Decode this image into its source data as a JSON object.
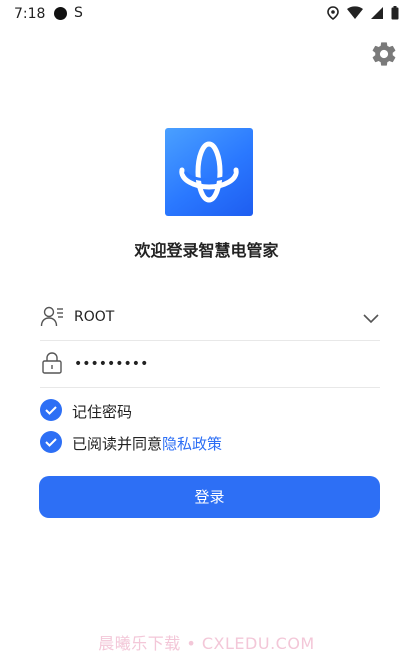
{
  "status_bar": {
    "time": "7:18",
    "icons": [
      "record-dot-icon",
      "s-app-icon",
      "location-icon",
      "wifi-icon",
      "signal-icon",
      "battery-icon"
    ]
  },
  "header": {
    "settings_icon": "gear-icon"
  },
  "app": {
    "logo_icon": "app-logo-icon",
    "title": "欢迎登录智慧电管家"
  },
  "form": {
    "username": {
      "value": "ROOT",
      "icon": "user-icon",
      "dropdown_icon": "chevron-down-icon"
    },
    "password": {
      "value": "•••••••••",
      "icon": "lock-icon"
    },
    "remember_password": {
      "label": "记住密码",
      "checked": true
    },
    "agree_policy": {
      "label_prefix": "已阅读并同意",
      "link": "隐私政策",
      "checked": true
    },
    "login_button": "登录"
  },
  "watermark": "晨曦乐下载 • CXLEDU.COM",
  "colors": {
    "accent": "#2d6ff5",
    "text": "#222222",
    "watermark": "#f3c7d8"
  }
}
